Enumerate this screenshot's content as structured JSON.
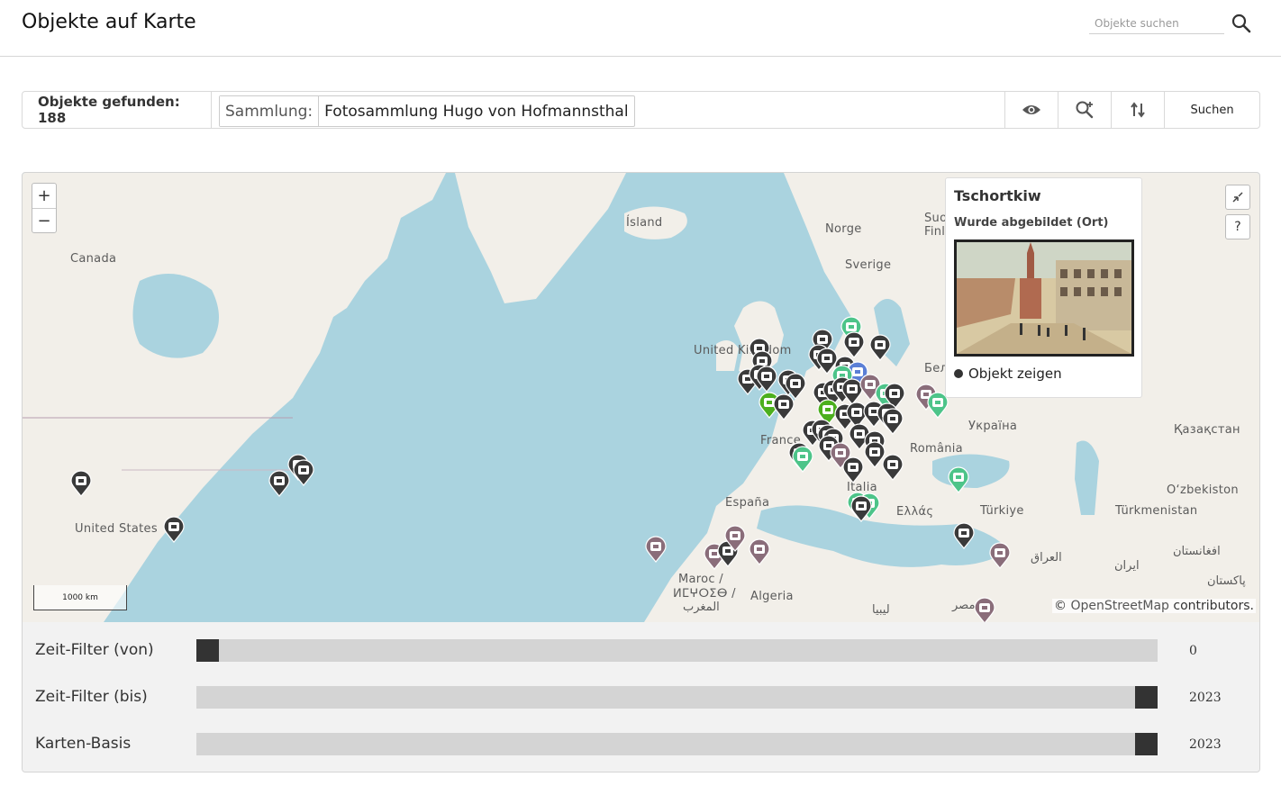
{
  "header": {
    "title": "Objekte auf Karte",
    "search_placeholder": "Objekte suchen",
    "search_icon": "search-icon"
  },
  "toolbar": {
    "found_label": "Objekte gefunden: 188",
    "filter_label": "Sammlung:",
    "filter_value": "Fotosammlung Hugo von Hofmannsthal",
    "icons": [
      "eye-icon",
      "zoom-in-icon",
      "sort-icon"
    ],
    "search_button": "Suchen"
  },
  "map": {
    "zoom_in": "+",
    "zoom_out": "−",
    "scale_label": "1000 km",
    "attribution_prefix": "©",
    "attribution_link": "OpenStreetMap",
    "attribution_suffix": "contributors.",
    "help_label": "?",
    "labels": {
      "canada": "Canada",
      "island": "Ísland",
      "norge": "Norge",
      "sverige": "Sverige",
      "suomi": "Suo",
      "finland": "Finl",
      "uk": "United Kingdom",
      "bel": "Бел",
      "ukraina": "Україна",
      "kazakhstan": "Қазақстан",
      "france": "France",
      "romania": "România",
      "italia": "Italia",
      "espana": "España",
      "ellas": "Ελλάς",
      "turkiye": "Türkiye",
      "uzbekiston": "O‘zbekiston",
      "turkmenistan": "Türkmenistan",
      "us": "United States",
      "maroc": "Maroc /",
      "maroc2": "ⵍⵎⵖⵔⵉⴱ /",
      "maroc3": "المغرب",
      "algeria": "Algeria",
      "libya": "ليبيا",
      "iraq": "العراق",
      "iran": "ایران",
      "afghanistan": "افغانستان",
      "pakistan": "پاکستان",
      "egypt": "مصر"
    }
  },
  "popup": {
    "title": "Tschortkiw",
    "subtitle": "Wurde abgebildet (Ort)",
    "link": "Objekt zeigen"
  },
  "sliders": [
    {
      "label": "Zeit-Filter (von)",
      "value": "0",
      "fraction": 0.0
    },
    {
      "label": "Zeit-Filter (bis)",
      "value": "2023",
      "fraction": 1.0
    },
    {
      "label": "Karten-Basis",
      "value": "2023",
      "fraction": 1.0
    }
  ],
  "colors": {
    "sea": "#aad3df",
    "land": "#f2efe9",
    "marker_dark": "#3a3a3a",
    "marker_green": "#4dc489",
    "marker_mauve": "#8a6d7a",
    "marker_lime": "#4caf1e",
    "marker_blue": "#5b7fd6"
  }
}
